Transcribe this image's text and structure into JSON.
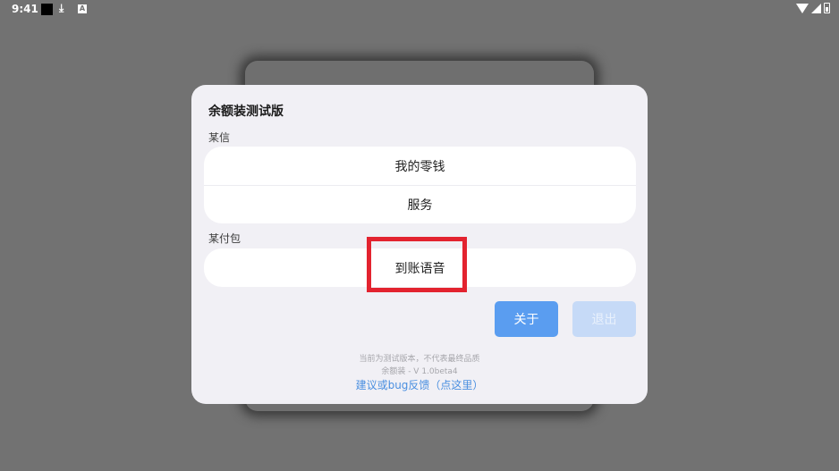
{
  "status_bar": {
    "time": "9:41",
    "icons": [
      "notification-square-icon",
      "download-icon",
      "a-icon",
      "wifi-icon",
      "signal-icon",
      "battery-icon"
    ]
  },
  "dialog": {
    "title": "余额装测试版",
    "sections": [
      {
        "label": "某信",
        "items": [
          "我的零钱",
          "服务"
        ]
      },
      {
        "label": "某付包",
        "items": [
          "到账语音"
        ]
      }
    ],
    "buttons": {
      "about": "关于",
      "exit": "退出"
    },
    "footer": {
      "notice": "当前为测试版本，不代表最终品质",
      "version": "余额装 - V 1.0beta4",
      "feedback_link": "建议或bug反馈（点这里）"
    }
  },
  "colors": {
    "overlay": "#727272",
    "dialog_bg": "#f1f0f5",
    "primary": "#5a9df0",
    "primary_disabled": "#c6daf7",
    "highlight": "#e3232f",
    "link": "#4a8fe0"
  }
}
